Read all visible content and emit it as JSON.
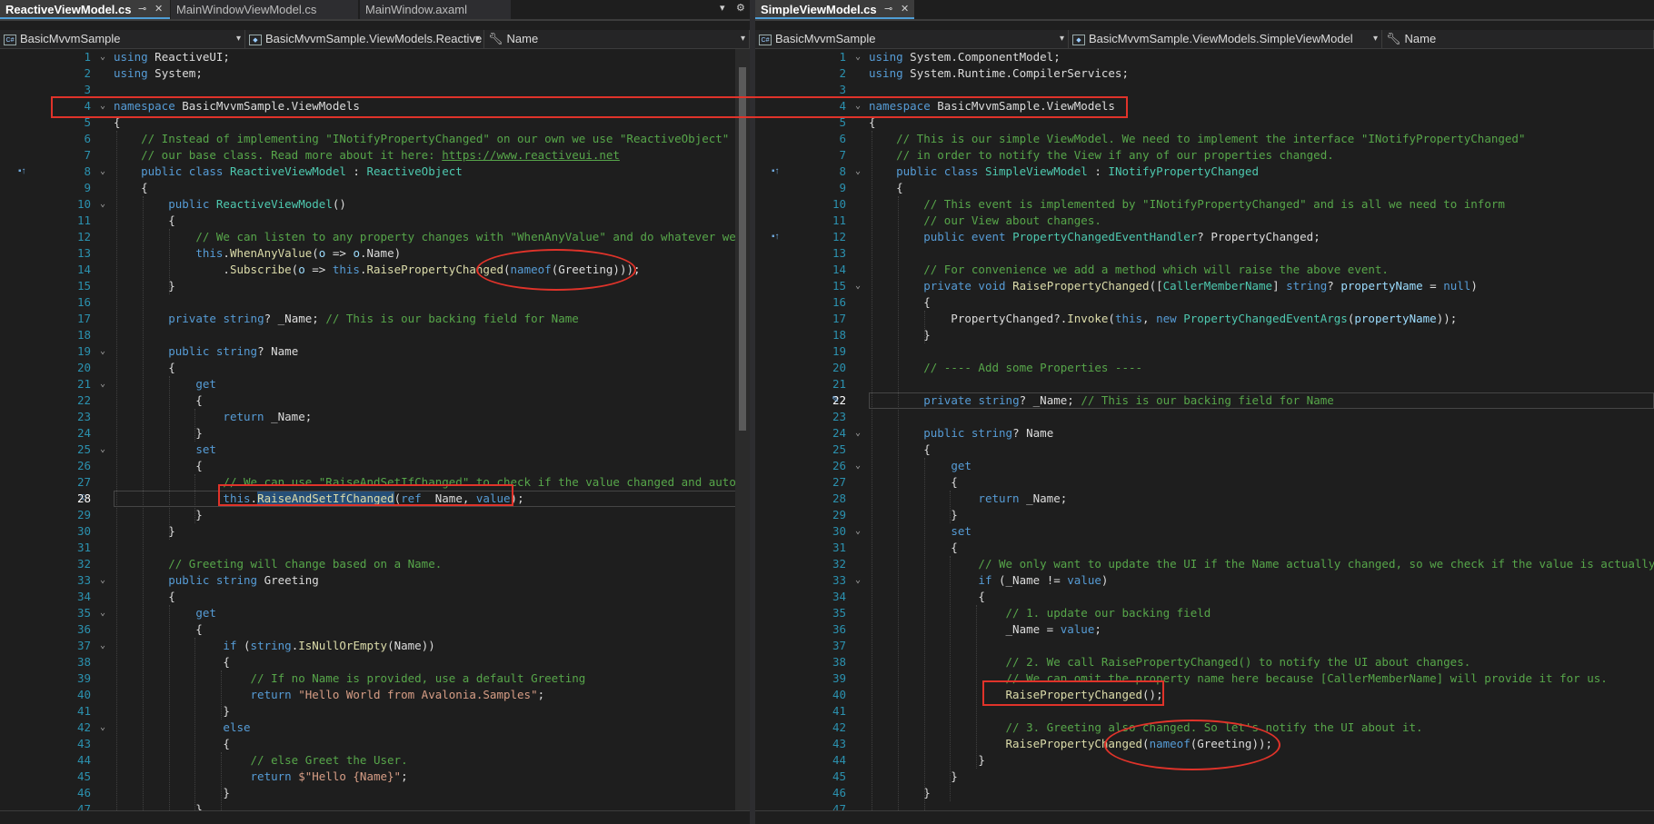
{
  "left": {
    "tabs": [
      {
        "label": "ReactiveViewModel.cs",
        "active": true
      },
      {
        "label": "MainWindowViewModel.cs",
        "active": false
      },
      {
        "label": "MainWindow.axaml",
        "active": false
      }
    ],
    "nav": {
      "project": "BasicMvvmSample",
      "type": "BasicMvvmSample.ViewModels.Reactive",
      "member": "Name"
    },
    "lines": [
      {
        "n": "1",
        "html": "<span class=\"kw\">using</span> ReactiveUI;"
      },
      {
        "n": "2",
        "html": "<span class=\"kw\">using</span> System;"
      },
      {
        "n": "3",
        "html": ""
      },
      {
        "n": "4",
        "html": "<span class=\"kw\">namespace</span> BasicMvvmSample.ViewModels"
      },
      {
        "n": "5",
        "html": "{"
      },
      {
        "n": "6",
        "html": "    <span class=\"cm\">// Instead of implementing \"INotifyPropertyChanged\" on our own we use \"ReactiveObject\" as</span>"
      },
      {
        "n": "7",
        "html": "    <span class=\"cm\">// our base class. Read more about it here: <span class=\"url\">https://www.reactiveui.net</span></span>"
      },
      {
        "n": "8",
        "html": "    <span class=\"kw\">public class</span> <span class=\"ty\">ReactiveViewModel</span> : <span class=\"ty\">ReactiveObject</span>"
      },
      {
        "n": "9",
        "html": "    {"
      },
      {
        "n": "10",
        "html": "        <span class=\"kw\">public</span> <span class=\"ty\">ReactiveViewModel</span>()"
      },
      {
        "n": "11",
        "html": "        {"
      },
      {
        "n": "12",
        "html": "            <span class=\"cm\">// We can listen to any property changes with \"WhenAnyValue\" and do whatever we wa</span>"
      },
      {
        "n": "13",
        "html": "            <span class=\"kw\">this</span>.<span class=\"mt\">WhenAnyValue</span>(<span class=\"pr\">o</span> =&gt; <span class=\"pr\">o</span>.Name)"
      },
      {
        "n": "14",
        "html": "                .<span class=\"mt\">Subscribe</span>(<span class=\"pr\">o</span> =&gt; <span class=\"kw\">this</span>.<span class=\"mt\">RaisePropertyChanged</span>(<span class=\"kw\">nameof</span>(Greeting)));"
      },
      {
        "n": "15",
        "html": "        }"
      },
      {
        "n": "16",
        "html": ""
      },
      {
        "n": "17",
        "html": "        <span class=\"kw\">private</span> <span class=\"kw\">string</span>? _Name; <span class=\"cm\">// This is our backing field for Name</span>"
      },
      {
        "n": "18",
        "html": ""
      },
      {
        "n": "19",
        "html": "        <span class=\"kw\">public</span> <span class=\"kw\">string</span>? Name"
      },
      {
        "n": "20",
        "html": "        {"
      },
      {
        "n": "21",
        "html": "            <span class=\"kw\">get</span>"
      },
      {
        "n": "22",
        "html": "            {"
      },
      {
        "n": "23",
        "html": "                <span class=\"kw\">return</span> _Name;"
      },
      {
        "n": "24",
        "html": "            }"
      },
      {
        "n": "25",
        "html": "            <span class=\"kw\">set</span>"
      },
      {
        "n": "26",
        "html": "            {"
      },
      {
        "n": "27",
        "html": "                <span class=\"cm\">// We can use \"RaiseAndSetIfChanged\" to check if the value changed and automat</span>"
      },
      {
        "n": "28",
        "html": "                <span class=\"kw\">this</span>.<span class=\"mt hl\">RaiseAndSetIfChanged</span>(<span class=\"kw\">ref</span> _Name, <span class=\"kw\">value</span>);"
      },
      {
        "n": "29",
        "html": "            }"
      },
      {
        "n": "30",
        "html": "        }"
      },
      {
        "n": "31",
        "html": ""
      },
      {
        "n": "32",
        "html": "        <span class=\"cm\">// Greeting will change based on a Name.</span>"
      },
      {
        "n": "33",
        "html": "        <span class=\"kw\">public</span> <span class=\"kw\">string</span> Greeting"
      },
      {
        "n": "34",
        "html": "        {"
      },
      {
        "n": "35",
        "html": "            <span class=\"kw\">get</span>"
      },
      {
        "n": "36",
        "html": "            {"
      },
      {
        "n": "37",
        "html": "                <span class=\"kw\">if</span> (<span class=\"kw\">string</span>.<span class=\"mt\">IsNullOrEmpty</span>(Name))"
      },
      {
        "n": "38",
        "html": "                {"
      },
      {
        "n": "39",
        "html": "                    <span class=\"cm\">// If no Name is provided, use a default Greeting</span>"
      },
      {
        "n": "40",
        "html": "                    <span class=\"kw\">return</span> <span class=\"st\">\"Hello World from Avalonia.Samples\"</span>;"
      },
      {
        "n": "41",
        "html": "                }"
      },
      {
        "n": "42",
        "html": "                <span class=\"kw\">else</span>"
      },
      {
        "n": "43",
        "html": "                {"
      },
      {
        "n": "44",
        "html": "                    <span class=\"cm\">// else Greet the User.</span>"
      },
      {
        "n": "45",
        "html": "                    <span class=\"kw\">return</span> <span class=\"st\">$\"Hello {Name}\"</span>;"
      },
      {
        "n": "46",
        "html": "                }"
      },
      {
        "n": "47",
        "html": "            }"
      }
    ]
  },
  "right": {
    "tabs": [
      {
        "label": "SimpleViewModel.cs",
        "active": true
      }
    ],
    "nav": {
      "project": "BasicMvvmSample",
      "type": "BasicMvvmSample.ViewModels.SimpleViewModel",
      "member": "Name"
    },
    "lines": [
      {
        "n": "1",
        "html": "<span class=\"kw\">using</span> System.ComponentModel;"
      },
      {
        "n": "2",
        "html": "<span class=\"kw\">using</span> System.Runtime.CompilerServices;"
      },
      {
        "n": "3",
        "html": ""
      },
      {
        "n": "4",
        "html": "<span class=\"kw\">namespace</span> BasicMvvmSample.ViewModels"
      },
      {
        "n": "5",
        "html": "{"
      },
      {
        "n": "6",
        "html": "    <span class=\"cm\">// This is our simple ViewModel. We need to implement the interface \"INotifyPropertyChanged\"</span>"
      },
      {
        "n": "7",
        "html": "    <span class=\"cm\">// in order to notify the View if any of our properties changed.</span>"
      },
      {
        "n": "8",
        "html": "    <span class=\"kw\">public class</span> <span class=\"ty\">SimpleViewModel</span> : <span class=\"ty\">INotifyPropertyChanged</span>"
      },
      {
        "n": "9",
        "html": "    {"
      },
      {
        "n": "10",
        "html": "        <span class=\"cm\">// This event is implemented by \"INotifyPropertyChanged\" and is all we need to inform</span>"
      },
      {
        "n": "11",
        "html": "        <span class=\"cm\">// our View about changes.</span>"
      },
      {
        "n": "12",
        "html": "        <span class=\"kw\">public event</span> <span class=\"ty\">PropertyChangedEventHandler</span>? PropertyChanged;"
      },
      {
        "n": "13",
        "html": ""
      },
      {
        "n": "14",
        "html": "        <span class=\"cm\">// For convenience we add a method which will raise the above event.</span>"
      },
      {
        "n": "15",
        "html": "        <span class=\"kw\">private void</span> <span class=\"mt\">RaisePropertyChanged</span>([<span class=\"ty\">CallerMemberName</span>] <span class=\"kw\">string</span>? <span class=\"pr\">propertyName</span> = <span class=\"kw\">null</span>)"
      },
      {
        "n": "16",
        "html": "        {"
      },
      {
        "n": "17",
        "html": "            PropertyChanged?.<span class=\"mt\">Invoke</span>(<span class=\"kw\">this</span>, <span class=\"kw\">new</span> <span class=\"ty\">PropertyChangedEventArgs</span>(<span class=\"pr\">propertyName</span>));"
      },
      {
        "n": "18",
        "html": "        }"
      },
      {
        "n": "19",
        "html": ""
      },
      {
        "n": "20",
        "html": "        <span class=\"cm\">// ---- Add some Properties ----</span>"
      },
      {
        "n": "21",
        "html": ""
      },
      {
        "n": "22",
        "html": "        <span class=\"kw\">private</span> <span class=\"kw\">string</span>? _Name; <span class=\"cm\">// This is our backing field for Name</span>"
      },
      {
        "n": "23",
        "html": ""
      },
      {
        "n": "24",
        "html": "        <span class=\"kw\">public</span> <span class=\"kw\">string</span>? Name"
      },
      {
        "n": "25",
        "html": "        {"
      },
      {
        "n": "26",
        "html": "            <span class=\"kw\">get</span>"
      },
      {
        "n": "27",
        "html": "            {"
      },
      {
        "n": "28",
        "html": "                <span class=\"kw\">return</span> _Name;"
      },
      {
        "n": "29",
        "html": "            }"
      },
      {
        "n": "30",
        "html": "            <span class=\"kw\">set</span>"
      },
      {
        "n": "31",
        "html": "            {"
      },
      {
        "n": "32",
        "html": "                <span class=\"cm\">// We only want to update the UI if the Name actually changed, so we check if the value is actually new</span>"
      },
      {
        "n": "33",
        "html": "                <span class=\"kw\">if</span> (_Name != <span class=\"kw\">value</span>)"
      },
      {
        "n": "34",
        "html": "                {"
      },
      {
        "n": "35",
        "html": "                    <span class=\"cm\">// 1. update our backing field</span>"
      },
      {
        "n": "36",
        "html": "                    _Name = <span class=\"kw\">value</span>;"
      },
      {
        "n": "37",
        "html": ""
      },
      {
        "n": "38",
        "html": "                    <span class=\"cm\">// 2. We call RaisePropertyChanged() to notify the UI about changes.</span>"
      },
      {
        "n": "39",
        "html": "                    <span class=\"cm\">// We can omit the property name here because [CallerMemberName] will provide it for us.</span>"
      },
      {
        "n": "40",
        "html": "                    <span class=\"mt\">RaisePropertyChanged</span>();"
      },
      {
        "n": "41",
        "html": ""
      },
      {
        "n": "42",
        "html": "                    <span class=\"cm\">// 3. Greeting also changed. So let's notify the UI about it.</span>"
      },
      {
        "n": "43",
        "html": "                    <span class=\"mt\">RaisePropertyChanged</span>(<span class=\"kw\">nameof</span>(Greeting));"
      },
      {
        "n": "44",
        "html": "                }"
      },
      {
        "n": "45",
        "html": "            }"
      },
      {
        "n": "46",
        "html": "        }"
      },
      {
        "n": "47",
        "html": ""
      }
    ]
  }
}
